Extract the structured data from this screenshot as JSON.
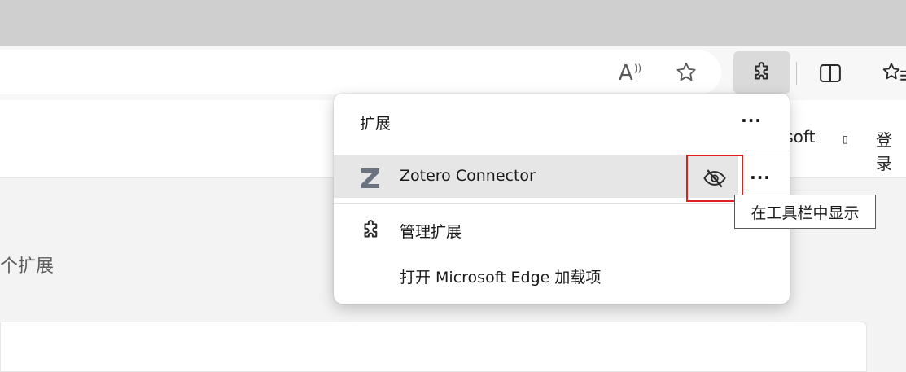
{
  "toolbar": {
    "read_aloud_icon": "read-aloud-icon",
    "favorite_icon": "star-icon",
    "extensions_icon": "puzzle-icon",
    "split_screen_icon": "split-screen-icon",
    "favorites_icon": "favorites-icon"
  },
  "page": {
    "nav_microsoft": "osoft",
    "nav_glyph": "▯",
    "nav_login": "登录",
    "extension_count_text": "个扩展"
  },
  "extensions_popup": {
    "title": "扩展",
    "more_label": "···",
    "items": [
      {
        "name": "Zotero Connector",
        "icon": "zotero-icon",
        "visibility_icon": "eye-hidden-icon",
        "more_label": "···"
      }
    ],
    "manage_label": "管理扩展",
    "open_addons_label": "打开 Microsoft Edge 加载项"
  },
  "tooltip": {
    "text": "在工具栏中显示"
  },
  "colors": {
    "highlight_border": "#e02020",
    "row_hover": "#e6e6e6",
    "button_active": "#dadada"
  }
}
